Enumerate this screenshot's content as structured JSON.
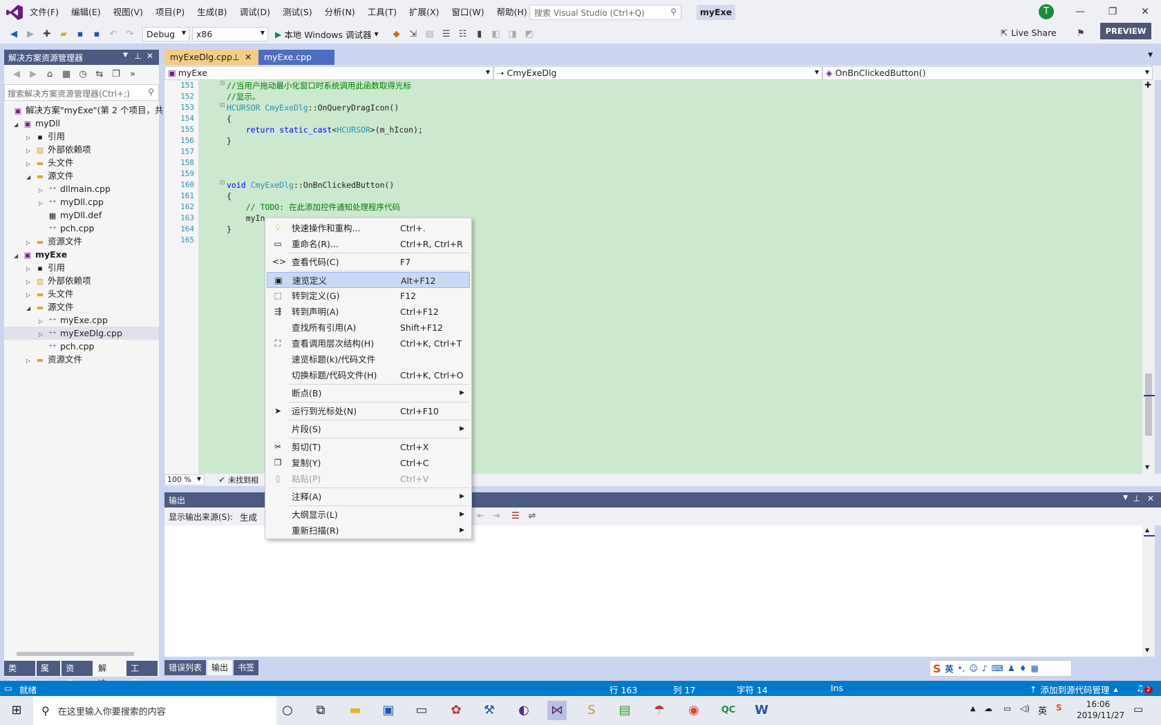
{
  "menu": [
    "文件(F)",
    "编辑(E)",
    "视图(V)",
    "项目(P)",
    "生成(B)",
    "调试(D)",
    "测试(S)",
    "分析(N)",
    "工具(T)",
    "扩展(X)",
    "窗口(W)",
    "帮助(H)"
  ],
  "search": {
    "placeholder": "搜索 Visual Studio (Ctrl+Q)"
  },
  "solution_name": "myExe",
  "avatar_initial": "T",
  "toolbar": {
    "config": "Debug",
    "platform": "x86",
    "debugger": "本地 Windows 调试器",
    "live_share": "Live Share",
    "preview": "PREVIEW"
  },
  "solution_explorer": {
    "title": "解决方案资源管理器",
    "search_placeholder": "搜索解决方案资源管理器(Ctrl+;)",
    "solution_label": "解决方案\"myExe\"(第 2 个项目，共",
    "project1": "myDll",
    "p1_items": [
      "引用",
      "外部依赖项",
      "头文件",
      "源文件"
    ],
    "p1_files": [
      "dllmain.cpp",
      "myDll.cpp",
      "myDll.def",
      "pch.cpp"
    ],
    "p1_res": "资源文件",
    "project2": "myExe",
    "p2_items": [
      "引用",
      "外部依赖项",
      "头文件",
      "源文件"
    ],
    "p2_files": [
      "myExe.cpp",
      "myExeDlg.cpp",
      "pch.cpp"
    ],
    "p2_res": "资源文件",
    "tabs": [
      "类视...",
      "属性",
      "资源...",
      "解决...",
      "工具..."
    ]
  },
  "doc_tabs": {
    "active": "myExeDlg.cpp",
    "inactive": "myExe.cpp"
  },
  "nav": {
    "project": "myExe",
    "class": "CmyExeDlg",
    "member": "OnBnClickedButton()"
  },
  "code": {
    "lines": [
      "151",
      "152",
      "153",
      "154",
      "155",
      "156",
      "157",
      "158",
      "159",
      "160",
      "161",
      "162",
      "163",
      "164",
      "165"
    ],
    "l151": "//当用户拖动最小化窗口时系统调用此函数取得光标",
    "l152": "//显示。",
    "l153_type": "HCURSOR",
    "l153_cls": "CmyExeDlg",
    "l153_fn": "::OnQueryDragIcon()",
    "l154": "{",
    "l155_kw": "return",
    "l155_cast": "static_cast",
    "l155_type": "HCURSOR",
    "l155_rest": "(m_hIcon);",
    "l156": "}",
    "l160_kw": "void",
    "l160_cls": "CmyExeDlg",
    "l160_fn": "::OnBnClickedButton()",
    "l161": "{",
    "l162": "// TODO: 在此添加控件通知处理程序代码",
    "l163": "myIn",
    "l164": "}"
  },
  "editor_status": {
    "zoom": "100 %",
    "issues": "未找到相"
  },
  "output": {
    "title": "输出",
    "source_label": "显示输出来源(S):",
    "source_value": "生成"
  },
  "bottom_tabs": [
    "错误列表",
    "输出",
    "书签"
  ],
  "context_menu": [
    {
      "icon": "lightbulb-icon",
      "label": "快速操作和重构...",
      "shortcut": "Ctrl+."
    },
    {
      "icon": "rename-icon",
      "label": "重命名(R)...",
      "shortcut": "Ctrl+R, Ctrl+R"
    },
    {
      "icon": "code-icon",
      "label": "查看代码(C)",
      "shortcut": "F7"
    },
    {
      "icon": "peek-icon",
      "label": "速览定义",
      "shortcut": "Alt+F12"
    },
    {
      "icon": "goto-def-icon",
      "label": "转到定义(G)",
      "shortcut": "F12"
    },
    {
      "icon": "goto-decl-icon",
      "label": "转到声明(A)",
      "shortcut": "Ctrl+F12"
    },
    {
      "icon": "",
      "label": "查找所有引用(A)",
      "shortcut": "Shift+F12"
    },
    {
      "icon": "call-hierarchy-icon",
      "label": "查看调用层次结构(H)",
      "shortcut": "Ctrl+K, Ctrl+T"
    },
    {
      "icon": "",
      "label": "速览标题(k)/代码文件",
      "shortcut": ""
    },
    {
      "icon": "",
      "label": "切换标题/代码文件(H)",
      "shortcut": "Ctrl+K, Ctrl+O"
    },
    {
      "icon": "",
      "label": "断点(B)",
      "shortcut": ""
    },
    {
      "icon": "cursor-icon",
      "label": "运行到光标处(N)",
      "shortcut": "Ctrl+F10"
    },
    {
      "icon": "",
      "label": "片段(S)",
      "shortcut": ""
    },
    {
      "icon": "scissors-icon",
      "label": "剪切(T)",
      "shortcut": "Ctrl+X"
    },
    {
      "icon": "copy-icon",
      "label": "复制(Y)",
      "shortcut": "Ctrl+C"
    },
    {
      "icon": "paste-icon",
      "label": "粘贴(P)",
      "shortcut": "Ctrl+V"
    },
    {
      "icon": "",
      "label": "注释(A)",
      "shortcut": ""
    },
    {
      "icon": "",
      "label": "大纲显示(L)",
      "shortcut": ""
    },
    {
      "icon": "",
      "label": "重新扫描(R)",
      "shortcut": ""
    }
  ],
  "status": {
    "ready": "就绪",
    "line": "行 163",
    "col": "列 17",
    "char": "字符 14",
    "mode": "Ins",
    "source_control": "添加到源代码管理",
    "notifications": "2"
  },
  "ime": {
    "lang": "英"
  },
  "taskbar": {
    "search_placeholder": "在这里输入你要搜索的内容",
    "tray_lang": "英",
    "time": "16:06",
    "date": "2019/11/27"
  }
}
